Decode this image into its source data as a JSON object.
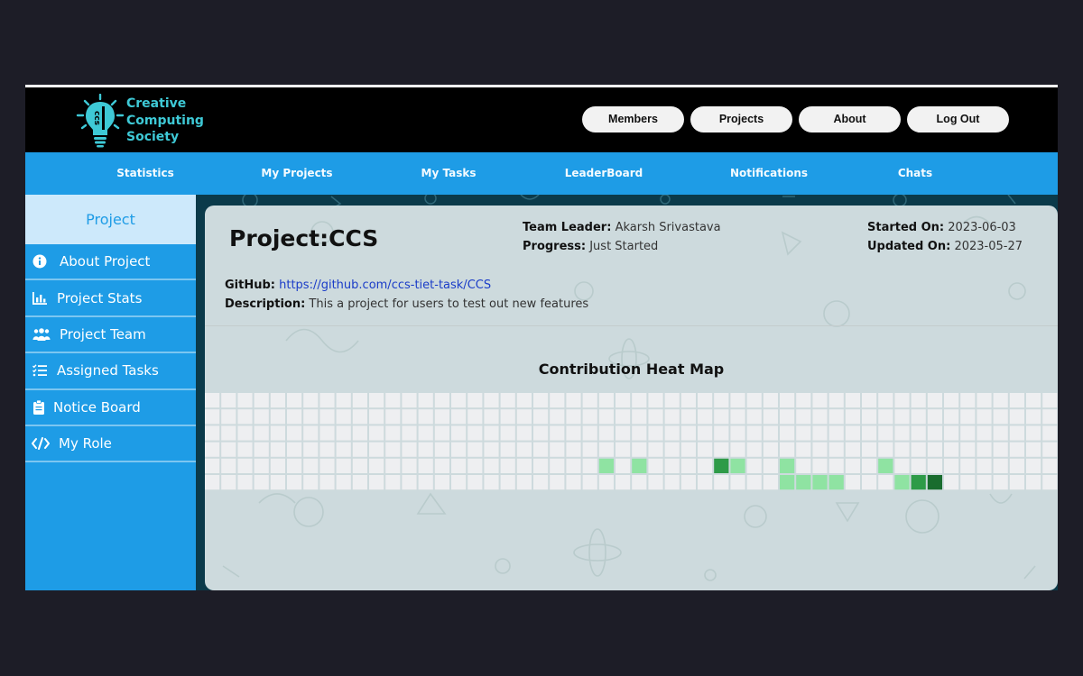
{
  "header": {
    "logo_lines": [
      "Creative",
      "Computing",
      "Society"
    ],
    "nav": [
      "Members",
      "Projects",
      "About",
      "Log Out"
    ]
  },
  "subnav": [
    "Statistics",
    "My Projects",
    "My Tasks",
    "LeaderBoard",
    "Notifications",
    "Chats"
  ],
  "sidebar": {
    "title": "Project",
    "items": [
      {
        "label": "About Project",
        "icon": "info-icon"
      },
      {
        "label": "Project Stats",
        "icon": "bar-chart-icon"
      },
      {
        "label": "Project Team",
        "icon": "team-icon"
      },
      {
        "label": "Assigned Tasks",
        "icon": "task-list-icon"
      },
      {
        "label": "Notice Board",
        "icon": "clipboard-icon"
      },
      {
        "label": "My Role",
        "icon": "code-icon"
      }
    ]
  },
  "project": {
    "title": "Project:CCS",
    "team_leader_label": "Team Leader:",
    "team_leader": "Akarsh Srivastava",
    "progress_label": "Progress:",
    "progress": "Just Started",
    "started_label": "Started On:",
    "started": "2023-06-03",
    "updated_label": "Updated On:",
    "updated": "2023-05-27",
    "github_label": "GitHub:",
    "github": "https://github.com/ccs-tiet-task/CCS",
    "description_label": "Description:",
    "description": "This a project for users to test out new features"
  },
  "heatmap": {
    "title": "Contribution Heat Map",
    "columns": 53,
    "rows": 6,
    "colors": {
      "empty": "#eeeff1",
      "l1": "#8fe3a2",
      "l2": "#2e9b48",
      "l3": "#196c2e"
    },
    "cells": [
      {
        "col": 24,
        "row": 4,
        "level": "l1"
      },
      {
        "col": 26,
        "row": 4,
        "level": "l1"
      },
      {
        "col": 31,
        "row": 4,
        "level": "l2"
      },
      {
        "col": 32,
        "row": 4,
        "level": "l1"
      },
      {
        "col": 35,
        "row": 4,
        "level": "l1"
      },
      {
        "col": 35,
        "row": 5,
        "level": "l1"
      },
      {
        "col": 36,
        "row": 5,
        "level": "l1"
      },
      {
        "col": 37,
        "row": 5,
        "level": "l1"
      },
      {
        "col": 38,
        "row": 5,
        "level": "l1"
      },
      {
        "col": 41,
        "row": 4,
        "level": "l1"
      },
      {
        "col": 42,
        "row": 5,
        "level": "l1"
      },
      {
        "col": 43,
        "row": 5,
        "level": "l2"
      },
      {
        "col": 44,
        "row": 5,
        "level": "l3"
      }
    ]
  },
  "colors": {
    "header_bg": "#000000",
    "nav_blue": "#1e9ce6",
    "logo_cyan": "#3ec9d6"
  }
}
